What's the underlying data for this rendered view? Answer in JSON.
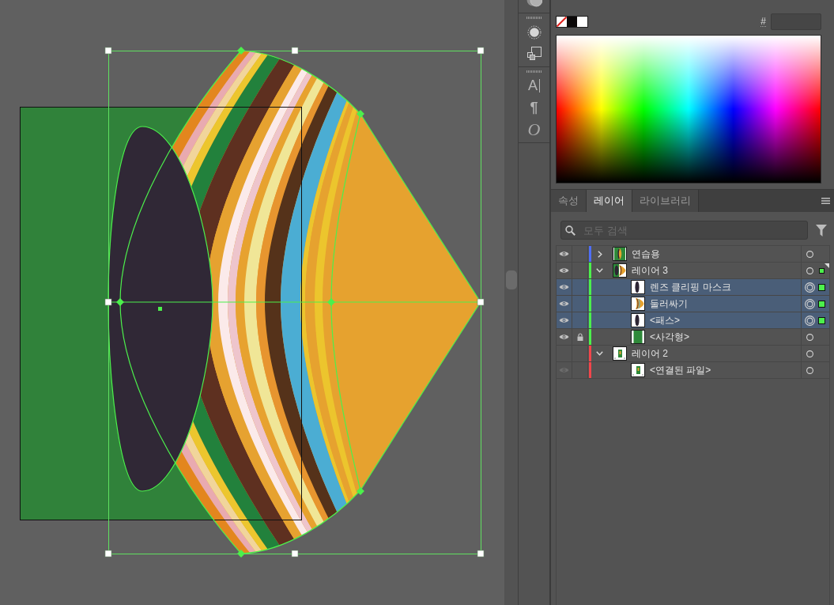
{
  "tool_strip": {
    "glyph_buttons": [
      "A",
      "¶",
      "O"
    ]
  },
  "color_panel": {
    "swatches": [
      {
        "kind": "none"
      },
      {
        "kind": "color",
        "color": "#0b0808"
      },
      {
        "kind": "color",
        "color": "#ffffff"
      }
    ],
    "hex_label": "#"
  },
  "layers_panel": {
    "tabs": [
      {
        "label": "속성",
        "selected": false
      },
      {
        "label": "레이어",
        "selected": true
      },
      {
        "label": "라이브러리",
        "selected": false
      }
    ],
    "search": {
      "placeholder": "모두 검색"
    },
    "layers": [
      {
        "name": "연습용",
        "kind": "poster",
        "color": "#4f6ff7",
        "visible": true,
        "locked": false,
        "expanded": false,
        "current": false,
        "selected": false,
        "contains_selection": false
      },
      {
        "name": "레이어 3",
        "kind": "composite",
        "color": "#4cf04c",
        "visible": true,
        "locked": false,
        "expanded": true,
        "current": true,
        "selected": false,
        "contains_selection": true,
        "children": [
          {
            "name": "렌즈 클리핑 마스크",
            "kind": "lens",
            "visible": true,
            "locked": false,
            "selected": true
          },
          {
            "name": "둘러싸기",
            "kind": "arcs",
            "visible": true,
            "locked": false,
            "selected": true
          },
          {
            "name": "<패스>",
            "kind": "lens",
            "visible": true,
            "locked": false,
            "selected": true
          },
          {
            "name": "<사각형>",
            "kind": "rect",
            "visible": true,
            "locked": true,
            "selected": false
          }
        ]
      },
      {
        "name": "레이어 2",
        "kind": "placed",
        "color": "#f2464b",
        "visible": false,
        "locked": false,
        "expanded": true,
        "current": false,
        "selected": false,
        "contains_selection": false,
        "children": [
          {
            "name": "<연결된 파일>",
            "kind": "placed",
            "visible": true,
            "locked": false,
            "selected": false
          }
        ]
      }
    ]
  }
}
